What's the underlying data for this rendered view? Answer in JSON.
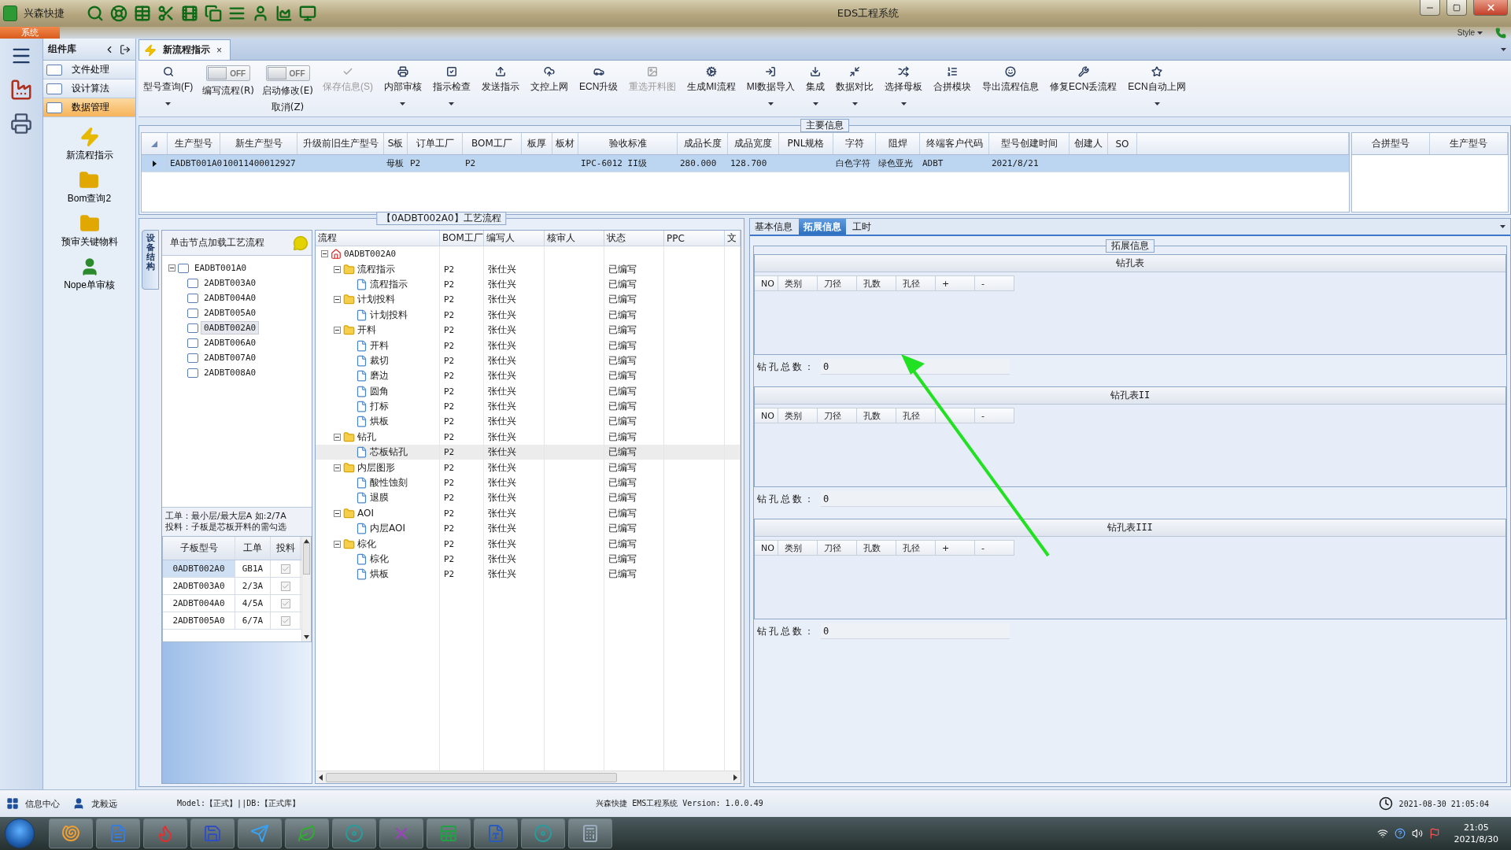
{
  "app": {
    "logo_name": "兴森快捷",
    "title": "EDS工程系统",
    "menu_tab": "系统",
    "style_label": "Style"
  },
  "sidebar": {
    "title": "组件库",
    "items": [
      {
        "label": "文件处理",
        "selected": false
      },
      {
        "label": "设计算法",
        "selected": false
      },
      {
        "label": "数据管理",
        "selected": true
      }
    ],
    "tools": [
      {
        "label": "新流程指示"
      },
      {
        "label": "Bom查询2"
      },
      {
        "label": "预审关键物料"
      },
      {
        "label": "Nope单审核"
      }
    ]
  },
  "document_tab": {
    "label": "新流程指示",
    "close": "×"
  },
  "toolbar": [
    {
      "kind": "button",
      "label": "型号查询(F)",
      "disabled": false,
      "dropdown": true
    },
    {
      "kind": "toggle",
      "label": "编写流程(R)",
      "on": false,
      "toggle_text": "OFF"
    },
    {
      "kind": "toggle",
      "label": "启动修改(E)",
      "label2": "取消(Z)",
      "on": false,
      "toggle_text": "OFF"
    },
    {
      "kind": "button",
      "label": "保存信息(S)",
      "disabled": true,
      "dropdown": false
    },
    {
      "kind": "button",
      "label": "内部审核",
      "disabled": false,
      "dropdown": true
    },
    {
      "kind": "button",
      "label": "指示检查",
      "disabled": false,
      "dropdown": true
    },
    {
      "kind": "button",
      "label": "发送指示",
      "disabled": false,
      "dropdown": false
    },
    {
      "kind": "button",
      "label": "文控上网",
      "disabled": false,
      "dropdown": false
    },
    {
      "kind": "button",
      "label": "ECN升级",
      "disabled": false,
      "dropdown": false
    },
    {
      "kind": "button",
      "label": "重选开料图",
      "disabled": true,
      "dropdown": false
    },
    {
      "kind": "button",
      "label": "生成MI流程",
      "disabled": false,
      "dropdown": false
    },
    {
      "kind": "button",
      "label": "MI数据导入",
      "disabled": false,
      "dropdown": true
    },
    {
      "kind": "button",
      "label": "集成",
      "disabled": false,
      "dropdown": true
    },
    {
      "kind": "button",
      "label": "数据对比",
      "disabled": false,
      "dropdown": true
    },
    {
      "kind": "button",
      "label": "选择母板",
      "disabled": false,
      "dropdown": true
    },
    {
      "kind": "button",
      "label": "合拼模块",
      "disabled": false,
      "dropdown": false
    },
    {
      "kind": "button",
      "label": "导出流程信息",
      "disabled": false,
      "dropdown": false
    },
    {
      "kind": "button",
      "label": "修复ECN丢流程",
      "disabled": false,
      "dropdown": false
    },
    {
      "kind": "button",
      "label": "ECN自动上网",
      "disabled": false,
      "dropdown": true
    }
  ],
  "main_info": {
    "title": "主要信息",
    "columns": [
      "生产型号",
      "新生产型号",
      "升级前旧生产型号",
      "S板",
      "订单工厂",
      "BOM工厂",
      "板厚",
      "板材",
      "验收标准",
      "成品长度",
      "成品宽度",
      "PNL规格",
      "字符",
      "阻焊",
      "终端客户代码",
      "型号创建时间",
      "创建人",
      "SO"
    ],
    "rows": [
      {
        "selected": true,
        "cells": [
          "EADBT001A0",
          "10011400012927",
          null,
          "母板",
          "P2",
          "P2",
          null,
          null,
          "IPC-6012 II级",
          "280.000",
          "128.700",
          null,
          "白色字符",
          "绿色亚光",
          "ADBT",
          "2021/8/21",
          null,
          null
        ]
      }
    ],
    "side_columns": [
      "合拼型号",
      "生产型号"
    ]
  },
  "process": {
    "title": "【0ADBT002A0】工艺流程",
    "side_tab": "设备结构",
    "hint": "单击节点加载工艺流程",
    "board_tree": {
      "label": "EADBT001A0",
      "expanded": true,
      "selected": false,
      "children": [
        {
          "label": "2ADBT003A0",
          "selected": false
        },
        {
          "label": "2ADBT004A0",
          "selected": false
        },
        {
          "label": "2ADBT005A0",
          "selected": false
        },
        {
          "label": "0ADBT002A0",
          "selected": true
        },
        {
          "label": "2ADBT006A0",
          "selected": false
        },
        {
          "label": "2ADBT007A0",
          "selected": false
        },
        {
          "label": "2ADBT008A0",
          "selected": false
        }
      ]
    },
    "notes": [
      "工单：最小层/最大层A 如:2/7A",
      "投料：子板是芯板开料的需勾选"
    ],
    "sub_table": {
      "columns": [
        "子板型号",
        "工单",
        "投料"
      ],
      "rows": [
        {
          "board": "0ADBT002A0",
          "order": "GB1A",
          "checked": true,
          "selected": true
        },
        {
          "board": "2ADBT003A0",
          "order": "2/3A",
          "checked": true,
          "selected": false
        },
        {
          "board": "2ADBT004A0",
          "order": "4/5A",
          "checked": true,
          "selected": false
        },
        {
          "board": "2ADBT005A0",
          "order": "6/7A",
          "checked": true,
          "selected": false
        }
      ]
    },
    "flow": {
      "columns": [
        "流程",
        "BOM工厂",
        "编写人",
        "核审人",
        "状态",
        "PPC",
        "文"
      ],
      "tree": {
        "label": "0ADBT002A0",
        "kind": "root",
        "expanded": true,
        "selected": false,
        "children": [
          {
            "label": "流程指示",
            "kind": "folder",
            "expanded": true,
            "selected": false,
            "bom": "P2",
            "writer": "张仕兴",
            "status": "已编写",
            "children": [
              {
                "label": "流程指示",
                "kind": "file",
                "selected": false,
                "bom": "P2",
                "writer": "张仕兴",
                "status": "已编写"
              }
            ]
          },
          {
            "label": "计划投料",
            "kind": "folder",
            "expanded": true,
            "selected": false,
            "bom": "P2",
            "writer": "张仕兴",
            "status": "已编写",
            "children": [
              {
                "label": "计划投料",
                "kind": "file",
                "selected": false,
                "bom": "P2",
                "writer": "张仕兴",
                "status": "已编写"
              }
            ]
          },
          {
            "label": "开料",
            "kind": "folder",
            "expanded": true,
            "selected": false,
            "bom": "P2",
            "writer": "张仕兴",
            "status": "已编写",
            "children": [
              {
                "label": "开料",
                "kind": "file",
                "selected": false,
                "bom": "P2",
                "writer": "张仕兴",
                "status": "已编写"
              },
              {
                "label": "裁切",
                "kind": "file",
                "selected": false,
                "bom": "P2",
                "writer": "张仕兴",
                "status": "已编写"
              },
              {
                "label": "磨边",
                "kind": "file",
                "selected": false,
                "bom": "P2",
                "writer": "张仕兴",
                "status": "已编写"
              },
              {
                "label": "圆角",
                "kind": "file",
                "selected": false,
                "bom": "P2",
                "writer": "张仕兴",
                "status": "已编写"
              },
              {
                "label": "打标",
                "kind": "file",
                "selected": false,
                "bom": "P2",
                "writer": "张仕兴",
                "status": "已编写"
              },
              {
                "label": "烘板",
                "kind": "file",
                "selected": false,
                "bom": "P2",
                "writer": "张仕兴",
                "status": "已编写"
              }
            ]
          },
          {
            "label": "钻孔",
            "kind": "folder",
            "expanded": true,
            "selected": false,
            "bom": "P2",
            "writer": "张仕兴",
            "status": "已编写",
            "children": [
              {
                "label": "芯板钻孔",
                "kind": "file",
                "selected": true,
                "bom": "P2",
                "writer": "张仕兴",
                "status": "已编写"
              }
            ]
          },
          {
            "label": "内层图形",
            "kind": "folder",
            "expanded": true,
            "selected": false,
            "bom": "P2",
            "writer": "张仕兴",
            "status": "已编写",
            "children": [
              {
                "label": "酸性蚀刻",
                "kind": "file",
                "selected": false,
                "bom": "P2",
                "writer": "张仕兴",
                "status": "已编写"
              },
              {
                "label": "退膜",
                "kind": "file",
                "selected": false,
                "bom": "P2",
                "writer": "张仕兴",
                "status": "已编写"
              }
            ]
          },
          {
            "label": "AOI",
            "kind": "folder",
            "expanded": true,
            "selected": false,
            "bom": "P2",
            "writer": "张仕兴",
            "status": "已编写",
            "children": [
              {
                "label": "内层AOI",
                "kind": "file",
                "selected": false,
                "bom": "P2",
                "writer": "张仕兴",
                "status": "已编写"
              }
            ]
          },
          {
            "label": "棕化",
            "kind": "folder",
            "expanded": true,
            "selected": false,
            "bom": "P2",
            "writer": "张仕兴",
            "status": "已编写",
            "children": [
              {
                "label": "棕化",
                "kind": "file",
                "selected": false,
                "bom": "P2",
                "writer": "张仕兴",
                "status": "已编写"
              },
              {
                "label": "烘板",
                "kind": "file",
                "selected": false,
                "bom": "P2",
                "writer": "张仕兴",
                "status": "已编写"
              }
            ]
          }
        ]
      }
    }
  },
  "detail": {
    "tabs": [
      {
        "label": "基本信息",
        "selected": false
      },
      {
        "label": "拓展信息",
        "selected": true
      },
      {
        "label": "工时",
        "selected": false
      }
    ],
    "title": "拓展信息",
    "sections": [
      {
        "title": "钻孔表",
        "columns": [
          "NO",
          "类别",
          "刀径",
          "孔数",
          "孔径",
          "+",
          "-"
        ],
        "total_label": "钻孔总数：",
        "total_value": "0"
      },
      {
        "title": "钻孔表II",
        "columns": [
          "NO",
          "类别",
          "刀径",
          "孔数",
          "孔径",
          null,
          "-"
        ],
        "total_label": "钻孔总数：",
        "total_value": "0"
      },
      {
        "title": "钻孔表III",
        "columns": [
          "NO",
          "类别",
          "刀径",
          "孔数",
          "孔径",
          "+",
          "-"
        ],
        "total_label": "钻孔总数：",
        "total_value": "0"
      }
    ]
  },
  "status_bar": {
    "info_center": "信息中心",
    "user": "龙毅远",
    "model": "Model:【正式】||DB:【正式库】",
    "product": "兴森快捷 EMS工程系统 Version: 1.0.0.49",
    "datetime": "2021-08-30 21:05:04"
  },
  "taskbar": {
    "time": "21:05",
    "date": "2021/8/30"
  }
}
